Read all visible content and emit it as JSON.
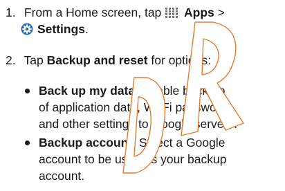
{
  "steps": [
    {
      "number": "1.",
      "prefix": "From a Home screen, tap",
      "apps_label": "Apps",
      "separator": ">",
      "settings_label": "Settings",
      "suffix": ".",
      "apps_icon": "apps-grid-icon",
      "settings_icon": "settings-gear-icon"
    },
    {
      "number": "2.",
      "prefix": "Tap",
      "bold": "Backup and reset",
      "suffix": "for options:"
    }
  ],
  "options": [
    {
      "title": "Back up my data",
      "lines": [
        ": Enable back up",
        "of application data, Wi-Fi passwords,",
        "and other settings to Google servers."
      ]
    },
    {
      "title": "Backup account",
      "lines": [
        ": Select a Google",
        "account to be used as your backup",
        "account."
      ]
    }
  ],
  "colors": {
    "text": "#1a1a1a",
    "watermark": "#e8792b",
    "settings_icon": "#2a6bb5"
  }
}
